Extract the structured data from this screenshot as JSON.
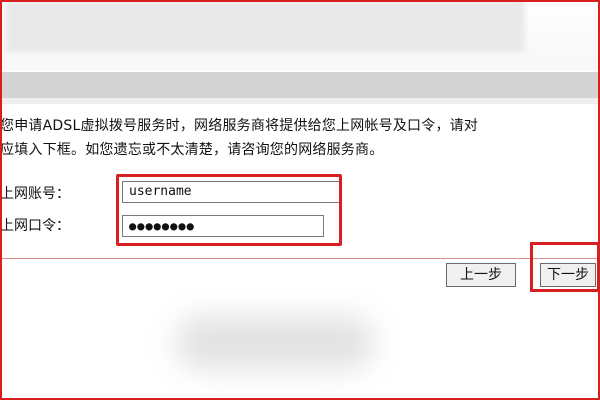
{
  "instructions": {
    "line1": "您申请ADSL虚拟拨号服务时，网络服务商将提供给您上网帐号及口令，请对",
    "line2": "应填入下框。如您遗忘或不太清楚，请咨询您的网络服务商。"
  },
  "form": {
    "username_label": "上网账号：",
    "username_value": "username",
    "password_label": "上网口令：",
    "password_value": "●●●●●●●●"
  },
  "buttons": {
    "prev_label": "上一步",
    "next_label": "下一步"
  },
  "colors": {
    "highlight": "#d81e1e",
    "band": "#d3d3d3"
  }
}
